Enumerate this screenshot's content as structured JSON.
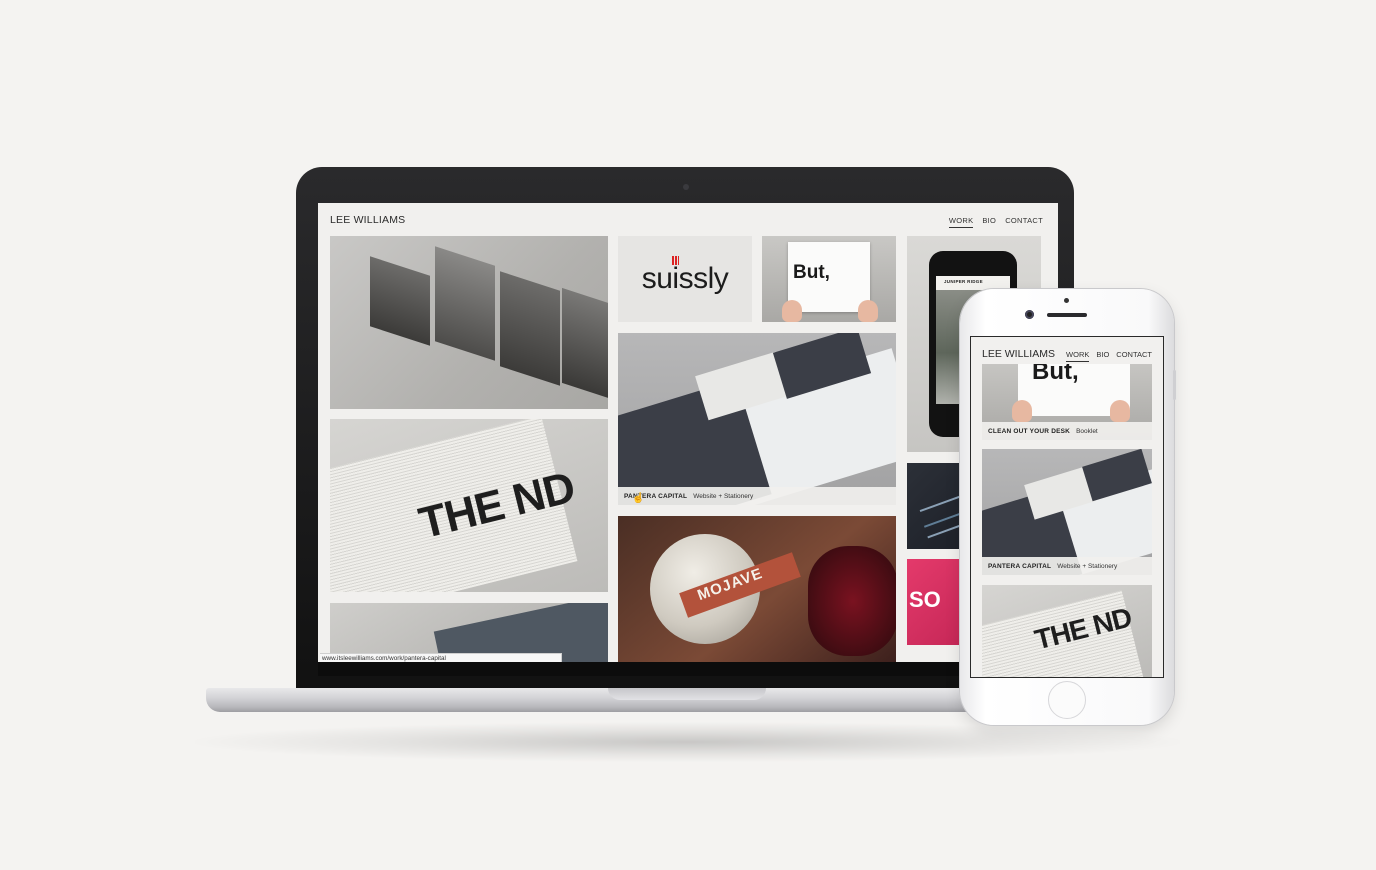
{
  "laptop": {
    "site": {
      "logo": "LEE WILLIAMS",
      "nav": [
        {
          "label": "WORK",
          "active": true
        },
        {
          "label": "BIO",
          "active": false
        },
        {
          "label": "CONTACT",
          "active": false
        }
      ]
    },
    "tiles": {
      "suissly_word": "suissly",
      "but_word": "But,",
      "newsprint_word": "THE ND",
      "pink_word": "SO",
      "mojave_word": "MOJAVE"
    },
    "caption": {
      "title": "PANTERA CAPITAL",
      "subtitle": "Website + Stationery"
    },
    "mini_phone_title": "JUNIPER RIDGE",
    "status_url": "www.itsleewilliams.com/work/pantera-capital"
  },
  "phone": {
    "site": {
      "logo": "LEE WILLIAMS",
      "nav": [
        {
          "label": "WORK",
          "active": true
        },
        {
          "label": "BIO",
          "active": false
        },
        {
          "label": "CONTACT",
          "active": false
        }
      ]
    },
    "tiles": {
      "but_word": "But,",
      "newsprint_word": "THE ND"
    },
    "captions": [
      {
        "title": "CLEAN OUT YOUR DESK",
        "subtitle": "Booklet"
      },
      {
        "title": "PANTERA CAPITAL",
        "subtitle": "Website + Stationery"
      }
    ]
  },
  "colors": {
    "page_background": "#f4f3f1",
    "site_background": "#f1f0ee",
    "accent_red": "#dd2222",
    "pink_tile": "#e43a6b"
  }
}
